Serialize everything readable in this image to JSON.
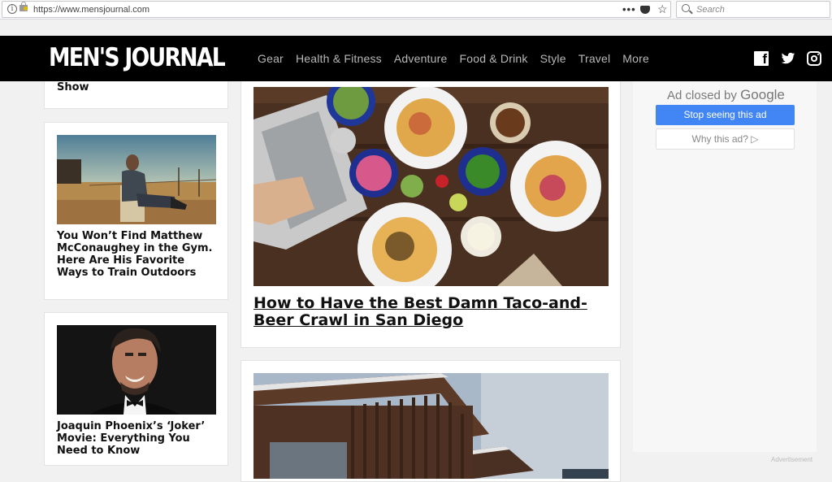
{
  "browser": {
    "url": "https://www.mensjournal.com",
    "search_placeholder": "Search",
    "menu_dots": "•••"
  },
  "header": {
    "logo": "MEN'S JOURNAL",
    "nav": [
      "Gear",
      "Health & Fitness",
      "Adventure",
      "Food & Drink",
      "Style",
      "Travel",
      "More"
    ],
    "social": [
      "facebook-icon",
      "twitter-icon",
      "instagram-icon"
    ]
  },
  "left_cards": [
    {
      "title": "Show"
    },
    {
      "title": "You Won’t Find Matthew McConaughey in the Gym. Here Are His Favorite Ways to Train Outdoors"
    },
    {
      "title": "Joaquin Phoenix’s ‘Joker’ Movie: Everything You Need to Know"
    }
  ],
  "main_cards": [
    {
      "title": "How to Have the Best Damn Taco-and-Beer Crawl in San Diego"
    }
  ],
  "ad": {
    "closed_prefix": "Ad closed by",
    "closed_brand": "Google",
    "stop_label": "Stop seeing this ad",
    "why_label": "Why this ad? ▷",
    "advertisement_label": "Advertisement"
  }
}
